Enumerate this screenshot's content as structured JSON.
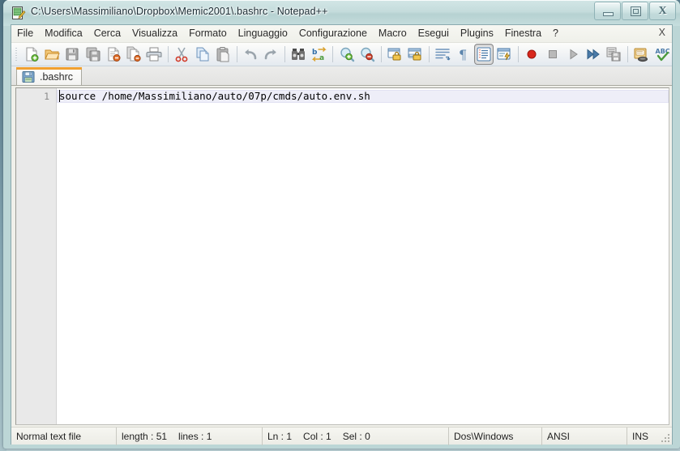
{
  "window": {
    "title": "C:\\Users\\Massimiliano\\Dropbox\\Memic2001\\.bashrc - Notepad++",
    "app_icon": "notepad-plus-plus-icon",
    "controls": {
      "minimize": "minimize-button",
      "maximize": "maximize-button",
      "close": "close-button",
      "close_glyph": "X"
    },
    "frame_color": "#bcd6d6"
  },
  "menubar": {
    "items": [
      {
        "label": "File"
      },
      {
        "label": "Modifica"
      },
      {
        "label": "Cerca"
      },
      {
        "label": "Visualizza"
      },
      {
        "label": "Formato"
      },
      {
        "label": "Linguaggio"
      },
      {
        "label": "Configurazione"
      },
      {
        "label": "Macro"
      },
      {
        "label": "Esegui"
      },
      {
        "label": "Plugins"
      },
      {
        "label": "Finestra"
      },
      {
        "label": "?"
      }
    ],
    "close_document": "X"
  },
  "toolbar": {
    "buttons": [
      {
        "name": "new-file-icon"
      },
      {
        "name": "open-file-icon"
      },
      {
        "name": "save-icon"
      },
      {
        "name": "save-all-icon"
      },
      {
        "name": "close-file-icon"
      },
      {
        "name": "close-all-files-icon"
      },
      {
        "name": "print-icon"
      },
      {
        "name": "cut-icon"
      },
      {
        "name": "copy-icon"
      },
      {
        "name": "paste-icon"
      },
      {
        "name": "undo-icon"
      },
      {
        "name": "redo-icon"
      },
      {
        "name": "find-icon"
      },
      {
        "name": "replace-icon"
      },
      {
        "name": "zoom-in-icon"
      },
      {
        "name": "zoom-out-icon"
      },
      {
        "name": "sync-vertical-scroll-icon"
      },
      {
        "name": "sync-horizontal-scroll-icon"
      },
      {
        "name": "word-wrap-icon"
      },
      {
        "name": "show-all-characters-icon"
      },
      {
        "name": "indent-guide-icon",
        "pressed": true
      },
      {
        "name": "user-defined-language-icon"
      },
      {
        "name": "record-macro-icon"
      },
      {
        "name": "stop-recording-macro-icon"
      },
      {
        "name": "play-macro-icon"
      },
      {
        "name": "run-macro-multiple-times-icon"
      },
      {
        "name": "save-current-macro-icon"
      },
      {
        "name": "run-icon"
      },
      {
        "name": "spell-check-icon"
      }
    ]
  },
  "tabs": [
    {
      "label": ".bashrc",
      "icon": "saved-file-icon",
      "active": true
    }
  ],
  "editor": {
    "lines": [
      {
        "number": "1",
        "text": "source /home/Massimiliano/auto/07p/cmds/auto.env.sh"
      }
    ],
    "current_line_highlight": "#eeeef8",
    "text_color": "#000000"
  },
  "statusbar": {
    "file_type": "Normal text file",
    "length_label": "length : 51",
    "lines_label": "lines : 1",
    "ln": "Ln : 1",
    "col": "Col : 1",
    "sel": "Sel : 0",
    "eol": "Dos\\Windows",
    "encoding": "ANSI",
    "insert_mode": "INS"
  }
}
